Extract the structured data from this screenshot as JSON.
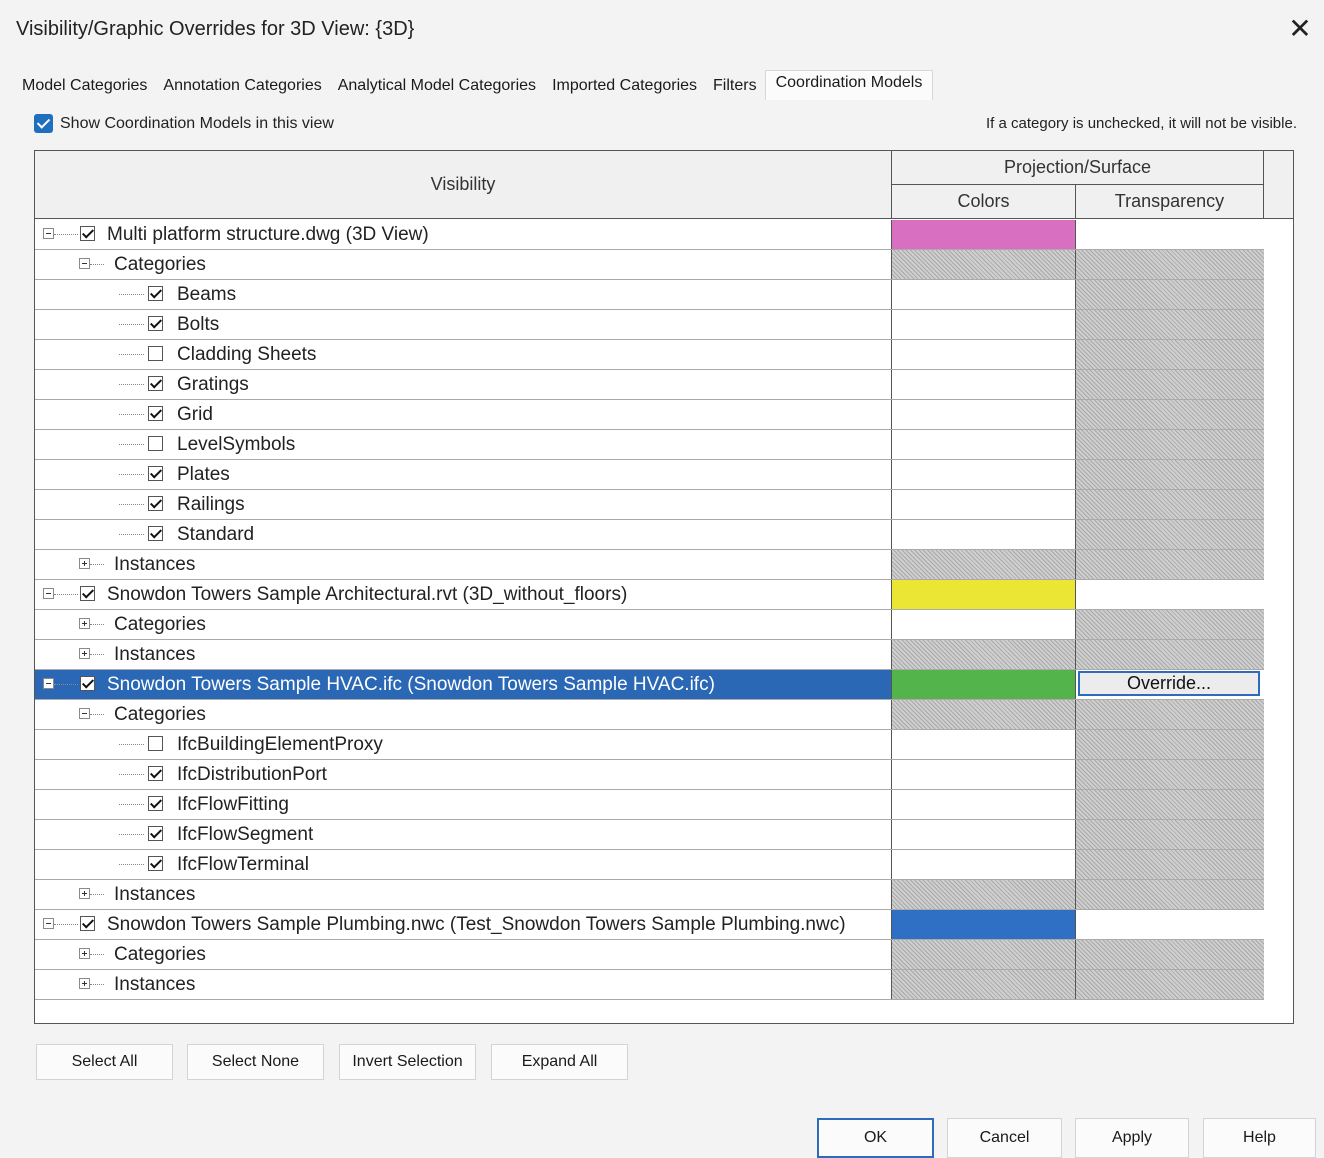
{
  "window": {
    "title": "Visibility/Graphic Overrides for 3D View: {3D}",
    "close_icon": "close-icon"
  },
  "tabs": [
    {
      "label": "Model Categories"
    },
    {
      "label": "Annotation Categories"
    },
    {
      "label": "Analytical Model Categories"
    },
    {
      "label": "Imported Categories"
    },
    {
      "label": "Filters"
    },
    {
      "label": "Coordination Models",
      "active": true
    }
  ],
  "show_models": {
    "label": "Show Coordination Models in this view",
    "checked": true
  },
  "hint": "If a category is unchecked, it will not be visible.",
  "grid": {
    "col_visibility": "Visibility",
    "col_projection": "Projection/Surface",
    "col_colors": "Colors",
    "col_transparency": "Transparency",
    "rows": [
      {
        "label": "Multi platform structure.dwg (3D View)",
        "level": 0,
        "expander": "minus",
        "checkbox": true,
        "color": "#d86fc0",
        "trans": "white"
      },
      {
        "label": "Categories",
        "level": 1,
        "expander": "minus",
        "color": "hatch",
        "trans": "hatch"
      },
      {
        "label": "Beams",
        "level": 2,
        "checkbox": true,
        "color": "white",
        "trans": "hatch"
      },
      {
        "label": "Bolts",
        "level": 2,
        "checkbox": true,
        "color": "white",
        "trans": "hatch"
      },
      {
        "label": "Cladding Sheets",
        "level": 2,
        "checkbox": false,
        "color": "white",
        "trans": "hatch"
      },
      {
        "label": "Gratings",
        "level": 2,
        "checkbox": true,
        "color": "white",
        "trans": "hatch"
      },
      {
        "label": "Grid",
        "level": 2,
        "checkbox": true,
        "color": "white",
        "trans": "hatch"
      },
      {
        "label": "LevelSymbols",
        "level": 2,
        "checkbox": false,
        "color": "white",
        "trans": "hatch"
      },
      {
        "label": "Plates",
        "level": 2,
        "checkbox": true,
        "color": "white",
        "trans": "hatch"
      },
      {
        "label": "Railings",
        "level": 2,
        "checkbox": true,
        "color": "white",
        "trans": "hatch"
      },
      {
        "label": "Standard",
        "level": 2,
        "checkbox": true,
        "color": "white",
        "trans": "hatch"
      },
      {
        "label": "Instances",
        "level": 1,
        "expander": "plus",
        "color": "hatch",
        "trans": "hatch"
      },
      {
        "label": "Snowdon Towers Sample Architectural.rvt (3D_without_floors)",
        "level": 0,
        "expander": "minus",
        "checkbox": true,
        "color": "#ebe534",
        "trans": "white"
      },
      {
        "label": "Categories",
        "level": 1,
        "expander": "plus",
        "color": "white",
        "trans": "hatch"
      },
      {
        "label": "Instances",
        "level": 1,
        "expander": "plus",
        "color": "hatch",
        "trans": "hatch"
      },
      {
        "label": "Snowdon Towers Sample HVAC.ifc (Snowdon Towers Sample HVAC.ifc)",
        "level": 0,
        "expander": "minus",
        "checkbox": true,
        "color": "#52b44a",
        "trans": "override",
        "selected": true
      },
      {
        "label": "Categories",
        "level": 1,
        "expander": "minus",
        "color": "hatch",
        "trans": "hatch"
      },
      {
        "label": "IfcBuildingElementProxy",
        "level": 2,
        "checkbox": false,
        "color": "white",
        "trans": "hatch"
      },
      {
        "label": "IfcDistributionPort",
        "level": 2,
        "checkbox": true,
        "color": "white",
        "trans": "hatch"
      },
      {
        "label": "IfcFlowFitting",
        "level": 2,
        "checkbox": true,
        "color": "white",
        "trans": "hatch"
      },
      {
        "label": "IfcFlowSegment",
        "level": 2,
        "checkbox": true,
        "color": "white",
        "trans": "hatch"
      },
      {
        "label": "IfcFlowTerminal",
        "level": 2,
        "checkbox": true,
        "color": "white",
        "trans": "hatch"
      },
      {
        "label": "Instances",
        "level": 1,
        "expander": "plus",
        "color": "hatch",
        "trans": "hatch"
      },
      {
        "label": "Snowdon Towers Sample Plumbing.nwc (Test_Snowdon Towers Sample Plumbing.nwc)",
        "level": 0,
        "expander": "minus",
        "checkbox": true,
        "color": "#2f6fc4",
        "trans": "white"
      },
      {
        "label": "Categories",
        "level": 1,
        "expander": "plus",
        "color": "hatch",
        "trans": "hatch"
      },
      {
        "label": "Instances",
        "level": 1,
        "expander": "plus",
        "color": "hatch",
        "trans": "hatch"
      }
    ]
  },
  "override_label": "Override...",
  "buttons": {
    "select_all": "Select All",
    "select_none": "Select None",
    "invert": "Invert Selection",
    "expand": "Expand All"
  },
  "dialog_buttons": {
    "ok": "OK",
    "cancel": "Cancel",
    "apply": "Apply",
    "help": "Help"
  },
  "colors": {
    "selection": "#2a67b5",
    "accent": "#1f6fbf"
  }
}
